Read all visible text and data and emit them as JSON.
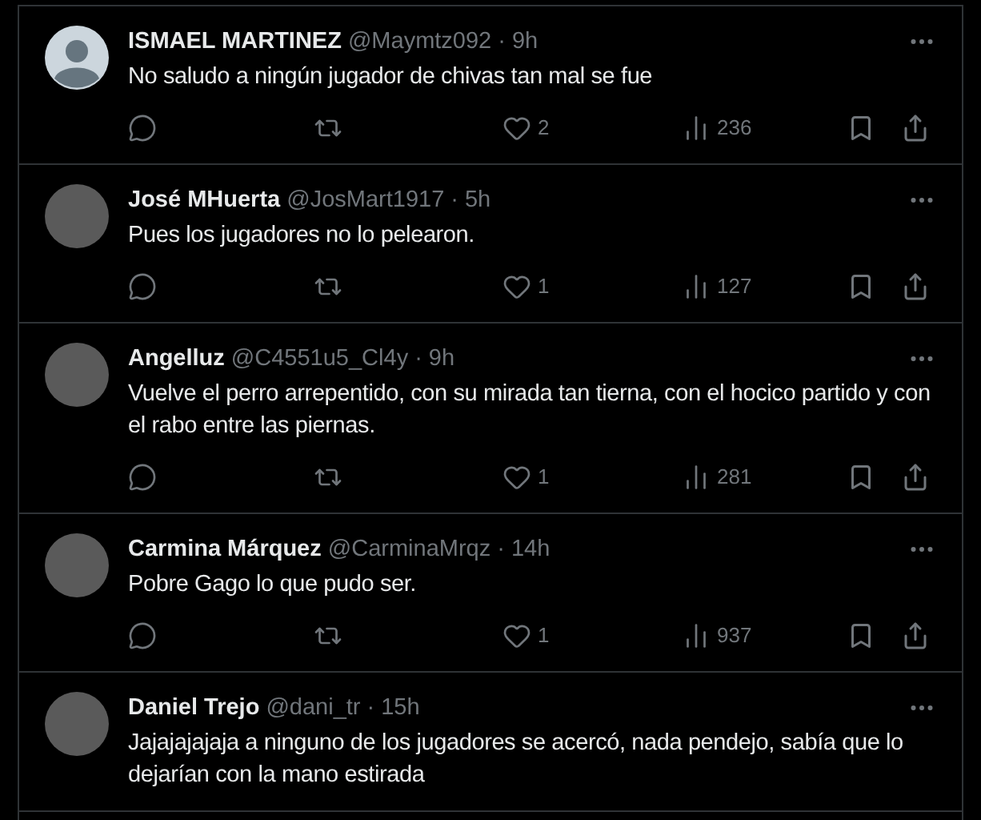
{
  "replies": [
    {
      "kind": "default",
      "name": "ISMAEL MARTINEZ",
      "handle": "@Maymtz092",
      "separator": "·",
      "time": "9h",
      "text": "No saludo a ningún jugador de chivas tan mal se fue",
      "stats": {
        "likes": "2",
        "views": "236"
      }
    },
    {
      "kind": "photo",
      "name": "José MHuerta",
      "handle": "@JosMart1917",
      "separator": "·",
      "time": "5h",
      "text": "Pues los jugadores no lo pelearon.",
      "stats": {
        "likes": "1",
        "views": "127"
      }
    },
    {
      "kind": "photo",
      "name": "Angelluz",
      "handle": "@C4551u5_Cl4y",
      "separator": "·",
      "time": "9h",
      "text": "Vuelve el perro arrepentido, con su mirada tan tierna, con el hocico partido y con el rabo entre las piernas.",
      "stats": {
        "likes": "1",
        "views": "281"
      }
    },
    {
      "kind": "photo",
      "name": "Carmina Márquez",
      "handle": "@CarminaMrqz",
      "separator": "·",
      "time": "14h",
      "text": "Pobre Gago lo que pudo ser.",
      "stats": {
        "likes": "1",
        "views": "937"
      }
    },
    {
      "kind": "photo",
      "name": "Daniel Trejo",
      "handle": "@dani_tr",
      "separator": "·",
      "time": "15h",
      "text": "Jajajajajaja a ninguno de los jugadores se acercó, nada pendejo, sabía que lo dejarían con la mano estirada"
    }
  ]
}
